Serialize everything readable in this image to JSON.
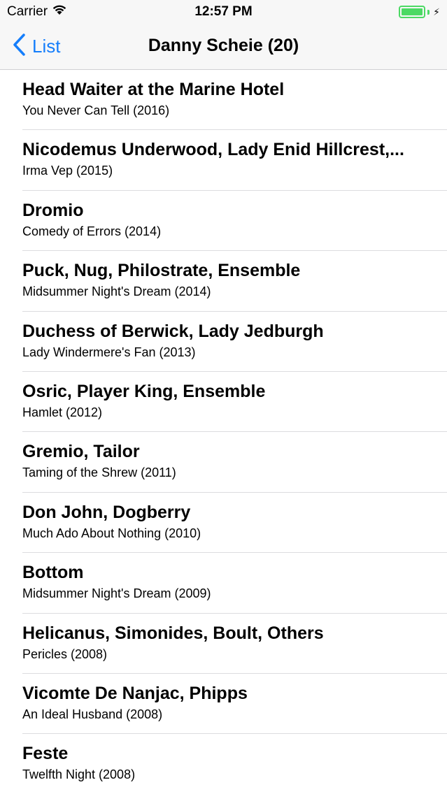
{
  "status": {
    "carrier": "Carrier",
    "time": "12:57 PM",
    "battery_color": "#4cd964"
  },
  "nav": {
    "back_label": "List",
    "title": "Danny Scheie (20)",
    "accent": "#157efb"
  },
  "roles": [
    {
      "title": "Head Waiter at the Marine Hotel",
      "subtitle": "You Never Can Tell (2016)"
    },
    {
      "title": "Nicodemus Underwood, Lady Enid Hillcrest,...",
      "subtitle": "Irma Vep (2015)"
    },
    {
      "title": "Dromio",
      "subtitle": "Comedy of Errors (2014)"
    },
    {
      "title": "Puck, Nug, Philostrate, Ensemble",
      "subtitle": "Midsummer Night's Dream (2014)"
    },
    {
      "title": "Duchess of Berwick, Lady Jedburgh",
      "subtitle": "Lady Windermere's Fan (2013)"
    },
    {
      "title": "Osric, Player King, Ensemble",
      "subtitle": "Hamlet (2012)"
    },
    {
      "title": "Gremio, Tailor",
      "subtitle": "Taming of the Shrew (2011)"
    },
    {
      "title": "Don John, Dogberry",
      "subtitle": "Much Ado About Nothing (2010)"
    },
    {
      "title": "Bottom",
      "subtitle": "Midsummer Night's Dream (2009)"
    },
    {
      "title": "Helicanus, Simonides, Boult, Others",
      "subtitle": "Pericles (2008)"
    },
    {
      "title": "Vicomte De Nanjac, Phipps",
      "subtitle": "An Ideal Husband (2008)"
    },
    {
      "title": "Feste",
      "subtitle": "Twelfth Night (2008)"
    }
  ]
}
